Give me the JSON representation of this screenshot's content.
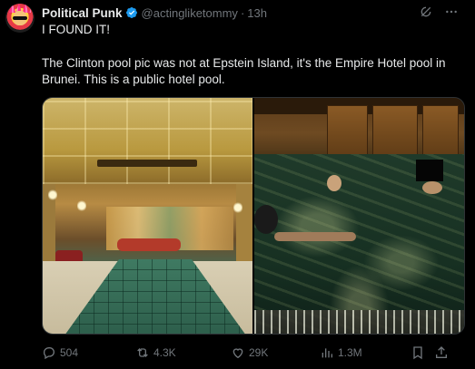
{
  "author": {
    "display_name": "Political Punk",
    "handle": "@actingliketommy",
    "separator": "·",
    "time": "13h",
    "verified": true,
    "verified_color": "#1d9bf0"
  },
  "tweet": {
    "line1": "I FOUND IT!",
    "paragraph": "The Clinton pool pic was not at Epstein Island, it's the Empire Hotel pool in Brunei. This is a public hotel pool."
  },
  "media": {
    "images": [
      {
        "name": "hotel-pool-photo"
      },
      {
        "name": "censored-pool-photo"
      }
    ]
  },
  "actions": {
    "replies": "504",
    "reposts": "4.3K",
    "likes": "29K",
    "views": "1.3M"
  },
  "icons": {
    "top": [
      "grok-icon",
      "more-icon"
    ],
    "bottom": [
      "reply-icon",
      "repost-icon",
      "like-icon",
      "views-icon",
      "bookmark-icon",
      "share-icon"
    ]
  },
  "colors": {
    "background": "#000000",
    "text": "#e7e9ea",
    "muted": "#71767b",
    "border": "#2f3336"
  }
}
